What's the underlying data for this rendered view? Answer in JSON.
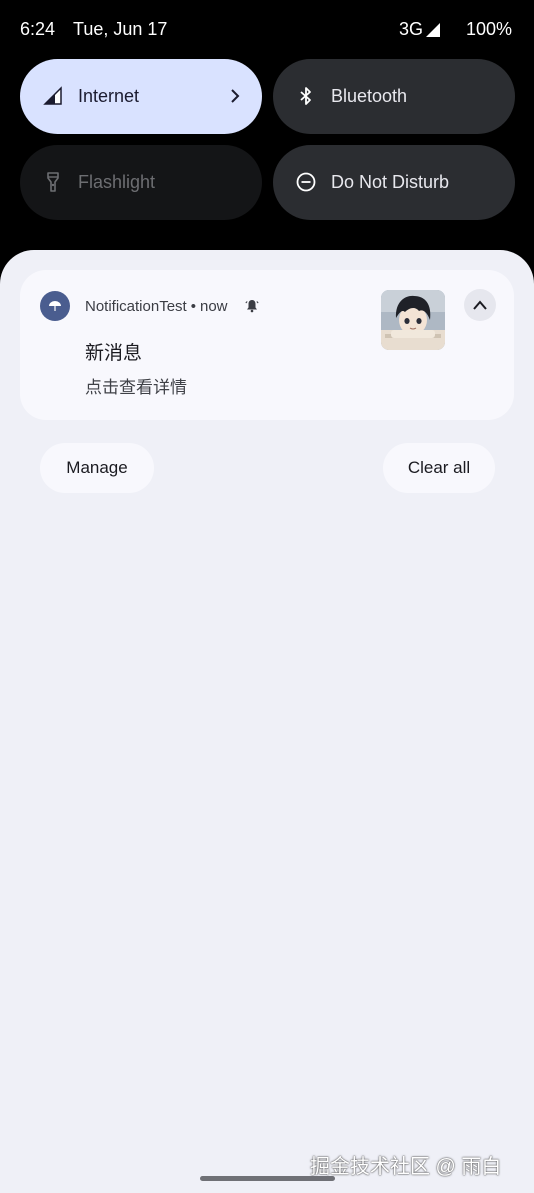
{
  "status_bar": {
    "time": "6:24",
    "date": "Tue, Jun 17",
    "network": "3G",
    "battery": "100%"
  },
  "quick_settings": {
    "tiles": [
      {
        "label": "Internet",
        "icon": "cellular-signal-icon",
        "state": "on",
        "has_chevron": true
      },
      {
        "label": "Bluetooth",
        "icon": "bluetooth-icon",
        "state": "off"
      },
      {
        "label": "Flashlight",
        "icon": "flashlight-icon",
        "state": "unavailable"
      },
      {
        "label": "Do Not Disturb",
        "icon": "do-not-disturb-icon",
        "state": "off"
      }
    ]
  },
  "notification": {
    "app_name": "NotificationTest",
    "separator": "•",
    "time": "now",
    "title": "新消息",
    "body": "点击查看详情",
    "alert_icon": "bell-icon",
    "expand_icon": "chevron-up-icon"
  },
  "actions": {
    "manage_label": "Manage",
    "clear_all_label": "Clear all"
  },
  "watermark": "掘金技术社区 @ 雨白",
  "colors": {
    "shade_background": "#eff0f7",
    "card_background": "#f8f8fd",
    "active_tile": "#d9e2ff",
    "inactive_tile": "#2b2d31",
    "disabled_tile": "#141517",
    "app_icon": "#4a5d8f"
  }
}
